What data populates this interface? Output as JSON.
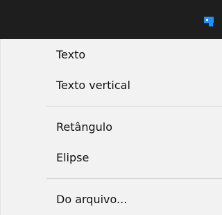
{
  "topbar": {
    "button_icon": "shape-insert-icon",
    "background_color": "#1e1e1e",
    "accent_color": "#1e90ff"
  },
  "menu": {
    "items": [
      {
        "label": "Texto"
      },
      {
        "label": "Texto vertical"
      },
      {
        "label": "Retângulo"
      },
      {
        "label": "Elipse"
      },
      {
        "label": "Do arquivo..."
      }
    ]
  }
}
